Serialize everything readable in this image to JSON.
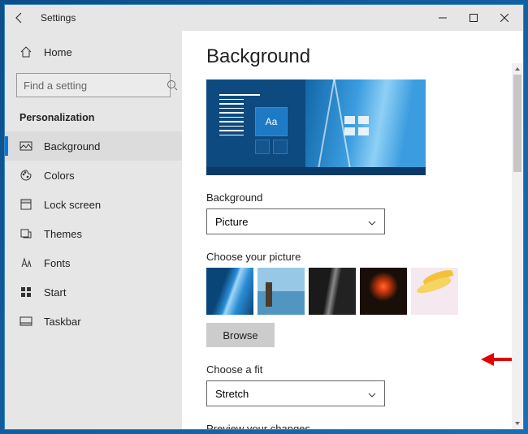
{
  "window": {
    "title": "Settings"
  },
  "sidebar": {
    "home_label": "Home",
    "search_placeholder": "Find a setting",
    "category": "Personalization",
    "items": [
      {
        "label": "Background",
        "icon": "picture-icon"
      },
      {
        "label": "Colors",
        "icon": "palette-icon"
      },
      {
        "label": "Lock screen",
        "icon": "lockscreen-icon"
      },
      {
        "label": "Themes",
        "icon": "themes-icon"
      },
      {
        "label": "Fonts",
        "icon": "fonts-icon"
      },
      {
        "label": "Start",
        "icon": "start-icon"
      },
      {
        "label": "Taskbar",
        "icon": "taskbar-icon"
      }
    ]
  },
  "page": {
    "title": "Background",
    "background_label": "Background",
    "background_value": "Picture",
    "choose_picture_label": "Choose your picture",
    "browse_label": "Browse",
    "choose_fit_label": "Choose a fit",
    "fit_value": "Stretch",
    "preview_changes_label": "Preview your changes",
    "preview_sample_text": "Aa"
  }
}
